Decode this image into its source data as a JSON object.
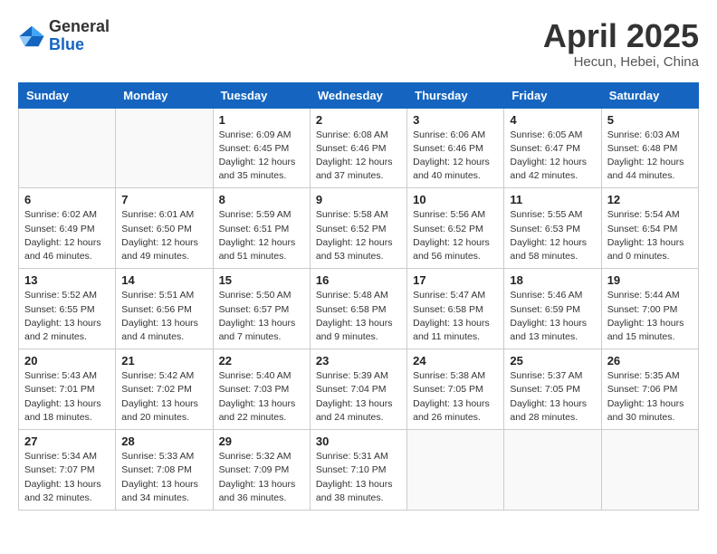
{
  "header": {
    "logo_general": "General",
    "logo_blue": "Blue",
    "title": "April 2025",
    "location": "Hecun, Hebei, China"
  },
  "weekdays": [
    "Sunday",
    "Monday",
    "Tuesday",
    "Wednesday",
    "Thursday",
    "Friday",
    "Saturday"
  ],
  "weeks": [
    [
      {
        "day": null
      },
      {
        "day": null
      },
      {
        "day": "1",
        "sunrise": "6:09 AM",
        "sunset": "6:45 PM",
        "daylight": "12 hours and 35 minutes."
      },
      {
        "day": "2",
        "sunrise": "6:08 AM",
        "sunset": "6:46 PM",
        "daylight": "12 hours and 37 minutes."
      },
      {
        "day": "3",
        "sunrise": "6:06 AM",
        "sunset": "6:46 PM",
        "daylight": "12 hours and 40 minutes."
      },
      {
        "day": "4",
        "sunrise": "6:05 AM",
        "sunset": "6:47 PM",
        "daylight": "12 hours and 42 minutes."
      },
      {
        "day": "5",
        "sunrise": "6:03 AM",
        "sunset": "6:48 PM",
        "daylight": "12 hours and 44 minutes."
      }
    ],
    [
      {
        "day": "6",
        "sunrise": "6:02 AM",
        "sunset": "6:49 PM",
        "daylight": "12 hours and 46 minutes."
      },
      {
        "day": "7",
        "sunrise": "6:01 AM",
        "sunset": "6:50 PM",
        "daylight": "12 hours and 49 minutes."
      },
      {
        "day": "8",
        "sunrise": "5:59 AM",
        "sunset": "6:51 PM",
        "daylight": "12 hours and 51 minutes."
      },
      {
        "day": "9",
        "sunrise": "5:58 AM",
        "sunset": "6:52 PM",
        "daylight": "12 hours and 53 minutes."
      },
      {
        "day": "10",
        "sunrise": "5:56 AM",
        "sunset": "6:52 PM",
        "daylight": "12 hours and 56 minutes."
      },
      {
        "day": "11",
        "sunrise": "5:55 AM",
        "sunset": "6:53 PM",
        "daylight": "12 hours and 58 minutes."
      },
      {
        "day": "12",
        "sunrise": "5:54 AM",
        "sunset": "6:54 PM",
        "daylight": "13 hours and 0 minutes."
      }
    ],
    [
      {
        "day": "13",
        "sunrise": "5:52 AM",
        "sunset": "6:55 PM",
        "daylight": "13 hours and 2 minutes."
      },
      {
        "day": "14",
        "sunrise": "5:51 AM",
        "sunset": "6:56 PM",
        "daylight": "13 hours and 4 minutes."
      },
      {
        "day": "15",
        "sunrise": "5:50 AM",
        "sunset": "6:57 PM",
        "daylight": "13 hours and 7 minutes."
      },
      {
        "day": "16",
        "sunrise": "5:48 AM",
        "sunset": "6:58 PM",
        "daylight": "13 hours and 9 minutes."
      },
      {
        "day": "17",
        "sunrise": "5:47 AM",
        "sunset": "6:58 PM",
        "daylight": "13 hours and 11 minutes."
      },
      {
        "day": "18",
        "sunrise": "5:46 AM",
        "sunset": "6:59 PM",
        "daylight": "13 hours and 13 minutes."
      },
      {
        "day": "19",
        "sunrise": "5:44 AM",
        "sunset": "7:00 PM",
        "daylight": "13 hours and 15 minutes."
      }
    ],
    [
      {
        "day": "20",
        "sunrise": "5:43 AM",
        "sunset": "7:01 PM",
        "daylight": "13 hours and 18 minutes."
      },
      {
        "day": "21",
        "sunrise": "5:42 AM",
        "sunset": "7:02 PM",
        "daylight": "13 hours and 20 minutes."
      },
      {
        "day": "22",
        "sunrise": "5:40 AM",
        "sunset": "7:03 PM",
        "daylight": "13 hours and 22 minutes."
      },
      {
        "day": "23",
        "sunrise": "5:39 AM",
        "sunset": "7:04 PM",
        "daylight": "13 hours and 24 minutes."
      },
      {
        "day": "24",
        "sunrise": "5:38 AM",
        "sunset": "7:05 PM",
        "daylight": "13 hours and 26 minutes."
      },
      {
        "day": "25",
        "sunrise": "5:37 AM",
        "sunset": "7:05 PM",
        "daylight": "13 hours and 28 minutes."
      },
      {
        "day": "26",
        "sunrise": "5:35 AM",
        "sunset": "7:06 PM",
        "daylight": "13 hours and 30 minutes."
      }
    ],
    [
      {
        "day": "27",
        "sunrise": "5:34 AM",
        "sunset": "7:07 PM",
        "daylight": "13 hours and 32 minutes."
      },
      {
        "day": "28",
        "sunrise": "5:33 AM",
        "sunset": "7:08 PM",
        "daylight": "13 hours and 34 minutes."
      },
      {
        "day": "29",
        "sunrise": "5:32 AM",
        "sunset": "7:09 PM",
        "daylight": "13 hours and 36 minutes."
      },
      {
        "day": "30",
        "sunrise": "5:31 AM",
        "sunset": "7:10 PM",
        "daylight": "13 hours and 38 minutes."
      },
      {
        "day": null
      },
      {
        "day": null
      },
      {
        "day": null
      }
    ]
  ],
  "labels": {
    "sunrise": "Sunrise:",
    "sunset": "Sunset:",
    "daylight": "Daylight:"
  }
}
